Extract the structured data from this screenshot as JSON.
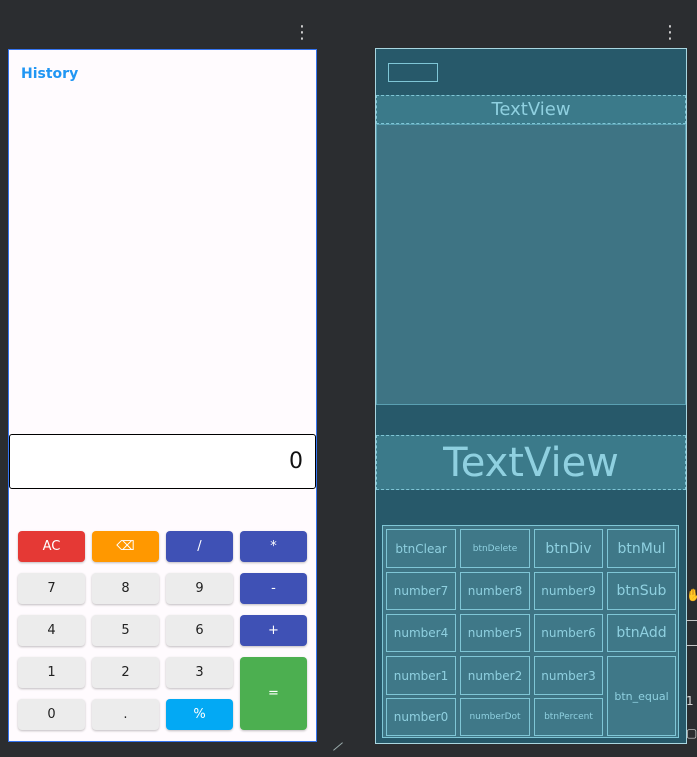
{
  "menu_icon": "⋮",
  "design": {
    "history_label": "History",
    "display_value": "0",
    "buttons": [
      {
        "label": "AC",
        "color": "#e53935"
      },
      {
        "label": "⌫",
        "color": "#ff9800"
      },
      {
        "label": "/",
        "color": "#3f51b5"
      },
      {
        "label": "*",
        "color": "#3f51b5"
      },
      {
        "label": "7"
      },
      {
        "label": "8"
      },
      {
        "label": "9"
      },
      {
        "label": "-",
        "color": "#3f51b5"
      },
      {
        "label": "4"
      },
      {
        "label": "5"
      },
      {
        "label": "6"
      },
      {
        "label": "+",
        "color": "#3f51b5"
      },
      {
        "label": "1"
      },
      {
        "label": "2"
      },
      {
        "label": "3"
      },
      {
        "label": "=",
        "color": "#4caf50"
      },
      {
        "label": "0"
      },
      {
        "label": "."
      },
      {
        "label": "%",
        "color": "#03a9f4"
      }
    ]
  },
  "blueprint": {
    "history_text": "TextView",
    "result_text": "TextView",
    "buttons": [
      "btnClear",
      "btnDelete",
      "btnDiv",
      "btnMul",
      "number7",
      "number8",
      "number9",
      "btnSub",
      "number4",
      "number5",
      "number6",
      "btnAdd",
      "number1",
      "number2",
      "number3",
      "btn_equal",
      "number0",
      "numberDot",
      "btnPercent"
    ]
  },
  "tools": [
    "1"
  ]
}
